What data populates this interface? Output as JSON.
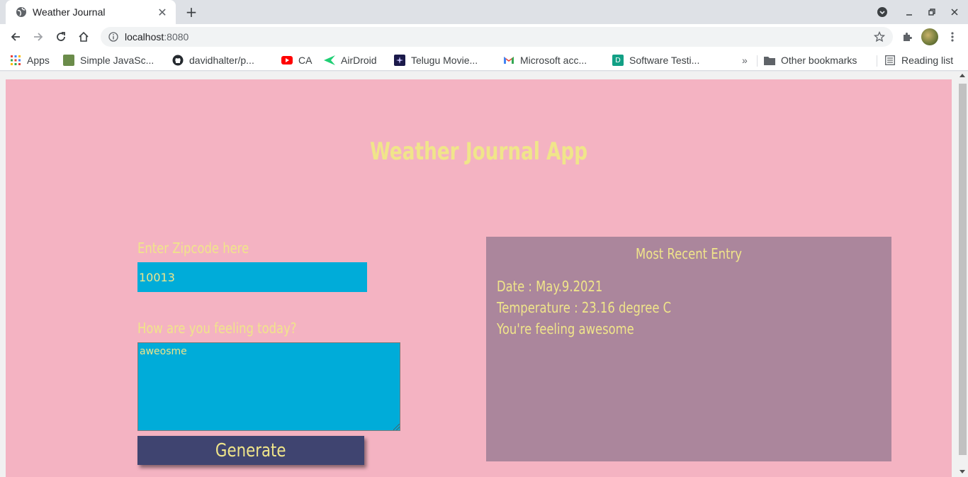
{
  "browser": {
    "tab_title": "Weather Journal",
    "url_host": "localhost",
    "url_port": ":8080",
    "bookmarks": [
      {
        "label": "Apps",
        "icon": "apps-grid-icon"
      },
      {
        "label": "Simple JavaSc...",
        "icon": "bookmark-thumbnail-icon"
      },
      {
        "label": "davidhalter/p...",
        "icon": "github-icon"
      },
      {
        "label": "CA",
        "icon": "youtube-icon"
      },
      {
        "label": "AirDroid",
        "icon": "airdroid-icon"
      },
      {
        "label": "Telugu Movie...",
        "icon": "movie-icon"
      },
      {
        "label": "Microsoft acc...",
        "icon": "gmail-icon"
      },
      {
        "label": "Software Testi...",
        "icon": "d-icon"
      }
    ],
    "overflow_label": "»",
    "other_bookmarks": "Other bookmarks",
    "reading_list": "Reading list"
  },
  "app": {
    "title": "Weather Journal App",
    "zip_label": "Enter Zipcode here",
    "zip_value": "10013",
    "feelings_label": "How are you feeling today?",
    "feelings_value": "aweosme",
    "generate_label": "Generate",
    "entry": {
      "heading": "Most Recent Entry",
      "date": "Date : May.9.2021",
      "temp": "Temperature : 23.16 degree C",
      "content": "You're feeling awesome"
    }
  },
  "colors": {
    "page_bg": "#f4b3c2",
    "accent_text": "#f0e58a",
    "input_bg": "#00acd9",
    "button_bg": "#3f4470",
    "panel_bg": "#ab869c"
  }
}
